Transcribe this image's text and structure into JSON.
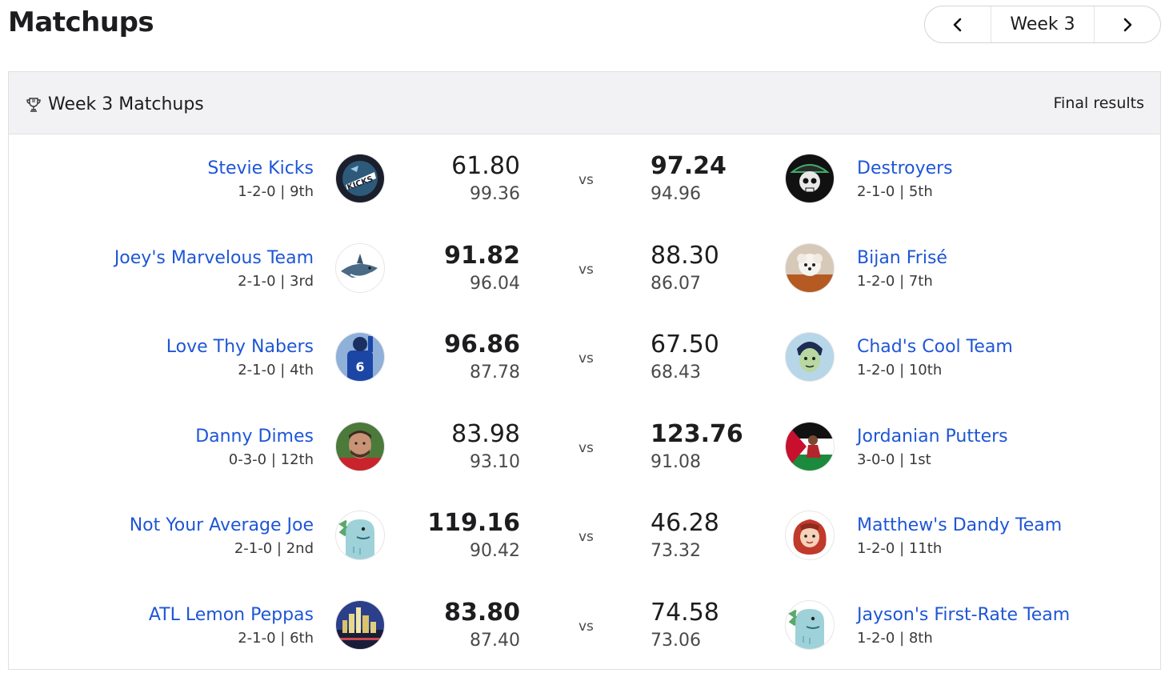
{
  "page": {
    "title": "Matchups"
  },
  "week_nav": {
    "label": "Week 3"
  },
  "card": {
    "title": "Week 3 Matchups",
    "status": "Final results"
  },
  "vs_label": "vs",
  "colors": {
    "link": "#1e56d6",
    "header_bg": "#f2f2f4"
  },
  "matchups": [
    {
      "left": {
        "name": "Stevie Kicks",
        "record": "1-2-0 | 9th",
        "score": "61.80",
        "projected": "99.36",
        "avatar": "kicks-logo",
        "winner": false
      },
      "right": {
        "name": "Destroyers",
        "record": "2-1-0 | 5th",
        "score": "97.24",
        "projected": "94.96",
        "avatar": "pirate-skull",
        "winner": true
      }
    },
    {
      "left": {
        "name": "Joey's Marvelous Team",
        "record": "2-1-0 | 3rd",
        "score": "91.82",
        "projected": "96.04",
        "avatar": "shark",
        "winner": true
      },
      "right": {
        "name": "Bijan Frisé",
        "record": "1-2-0 | 7th",
        "score": "88.30",
        "projected": "86.07",
        "avatar": "dog-football",
        "winner": false
      }
    },
    {
      "left": {
        "name": "Love Thy Nabers",
        "record": "2-1-0 | 4th",
        "score": "96.86",
        "projected": "87.78",
        "avatar": "football-player-6",
        "winner": true
      },
      "right": {
        "name": "Chad's Cool Team",
        "record": "1-2-0 | 10th",
        "score": "67.50",
        "projected": "68.43",
        "avatar": "cartoon-face-green",
        "winner": false
      }
    },
    {
      "left": {
        "name": "Danny Dimes",
        "record": "0-3-0 | 12th",
        "score": "83.98",
        "projected": "93.10",
        "avatar": "man-photo",
        "winner": false
      },
      "right": {
        "name": "Jordanian Putters",
        "record": "3-0-0 | 1st",
        "score": "123.76",
        "projected": "91.08",
        "avatar": "flag-player",
        "winner": true
      }
    },
    {
      "left": {
        "name": "Not Your Average Joe",
        "record": "2-1-0 | 2nd",
        "score": "119.16",
        "projected": "90.42",
        "avatar": "dino",
        "winner": true
      },
      "right": {
        "name": "Matthew's Dandy Team",
        "record": "1-2-0 | 11th",
        "score": "46.28",
        "projected": "73.32",
        "avatar": "redhead-cartoon",
        "winner": false
      }
    },
    {
      "left": {
        "name": "ATL Lemon Peppas",
        "record": "2-1-0 | 6th",
        "score": "83.80",
        "projected": "87.40",
        "avatar": "city-skyline",
        "winner": true
      },
      "right": {
        "name": "Jayson's First-Rate Team",
        "record": "1-2-0 | 8th",
        "score": "74.58",
        "projected": "73.06",
        "avatar": "dino",
        "winner": false
      }
    }
  ]
}
